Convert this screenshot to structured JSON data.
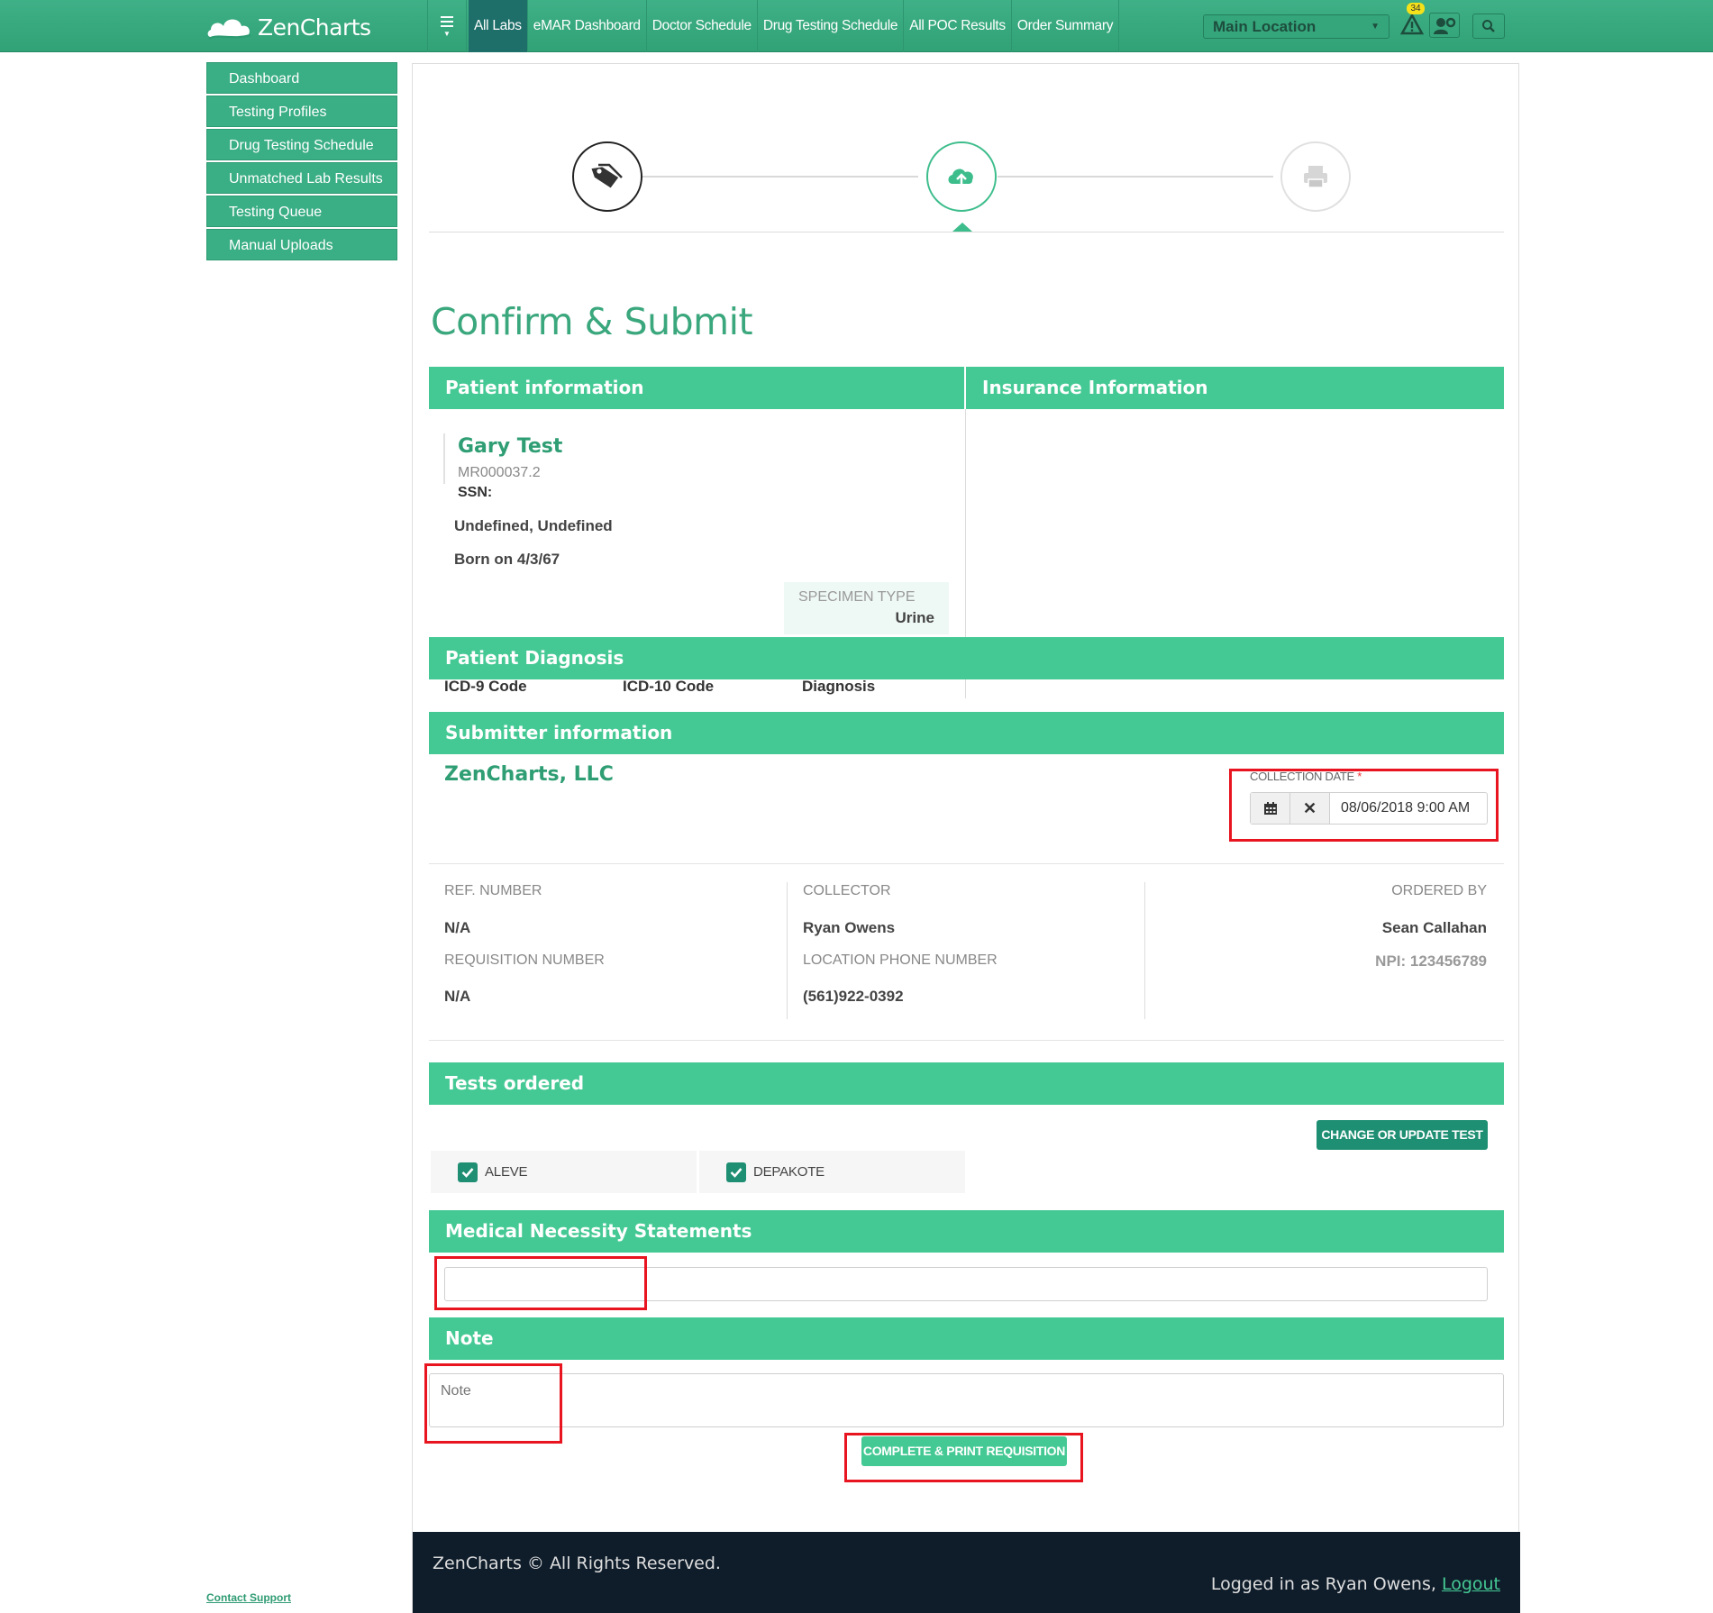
{
  "app": {
    "name": "ZenCharts"
  },
  "nav": {
    "links": [
      "All Labs",
      "eMAR Dashboard",
      "Doctor Schedule",
      "Drug Testing Schedule",
      "All POC Results",
      "Order Summary"
    ],
    "location": "Main Location",
    "alert_count": "34"
  },
  "sidebar": {
    "items": [
      "Dashboard",
      "Testing Profiles",
      "Drug Testing Schedule",
      "Unmatched Lab Results",
      "Testing Queue",
      "Manual Uploads"
    ],
    "contact_support": "Contact Support"
  },
  "wizard": {
    "steps": [
      "tag-icon",
      "cloud-upload-icon",
      "printer-icon"
    ],
    "current_step": 2
  },
  "page": {
    "title": "Confirm & Submit"
  },
  "patient": {
    "section_title": "Patient information",
    "name": "Gary Test",
    "mr_number": "MR000037.2",
    "ssn_label": "SSN:",
    "address": "Undefined, Undefined",
    "born": "Born on 4/3/67",
    "specimen_label": "SPECIMEN TYPE",
    "specimen_value": "Urine"
  },
  "insurance": {
    "section_title": "Insurance Information"
  },
  "diagnosis": {
    "section_title": "Patient Diagnosis",
    "columns": [
      "ICD-9 Code",
      "ICD-10 Code",
      "Diagnosis"
    ]
  },
  "submitter": {
    "section_title": "Submitter information",
    "company": "ZenCharts, LLC",
    "collection_date_label": "COLLECTION DATE",
    "collection_date_value": "08/06/2018 9:00 AM",
    "ref_label": "REF. NUMBER",
    "ref_value": "N/A",
    "req_label": "REQUISITION NUMBER",
    "req_value": "N/A",
    "collector_label": "COLLECTOR",
    "collector_value": "Ryan Owens",
    "phone_label": "LOCATION PHONE NUMBER",
    "phone_value": "(561)922-0392",
    "ordered_by_label": "ORDERED BY",
    "ordered_by_value": "Sean Callahan",
    "npi": "NPI: 123456789"
  },
  "tests": {
    "section_title": "Tests ordered",
    "change_button": "CHANGE OR UPDATE TEST",
    "items": [
      "ALEVE",
      "DEPAKOTE"
    ]
  },
  "medical_necessity": {
    "section_title": "Medical Necessity Statements",
    "value": ""
  },
  "note": {
    "section_title": "Note",
    "placeholder": "Note"
  },
  "actions": {
    "complete_button": "COMPLETE & PRINT REQUISITION"
  },
  "footer": {
    "copyright": "ZenCharts © All Rights Reserved.",
    "logged_in_prefix": "Logged in as Ryan Owens, ",
    "logout": "Logout"
  },
  "colors": {
    "brand": "#45c994",
    "dark_brand": "#1f8f73",
    "highlight": "#e8141f",
    "footer": "#0f1d2b"
  }
}
